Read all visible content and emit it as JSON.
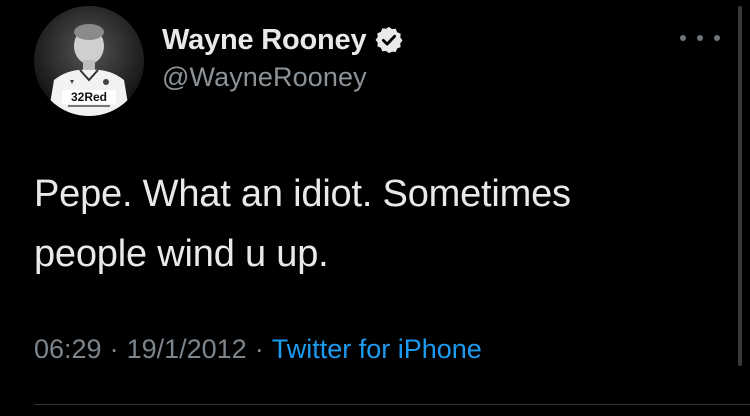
{
  "tweet": {
    "display_name": "Wayne Rooney",
    "handle": "@WayneRooney",
    "text": "Pepe. What an idiot. Sometimes\npeople wind u up.",
    "time": "06:29",
    "separator": "·",
    "date": "19/1/2012",
    "source": "Twitter for iPhone",
    "avatar_shirt_text": "32Red"
  },
  "icons": {
    "verified": "verified-badge-icon",
    "more": "more-options-icon"
  },
  "colors": {
    "background": "#000000",
    "text_primary": "#e7e9ea",
    "text_secondary": "#7d858c",
    "link": "#1d9bf0"
  }
}
